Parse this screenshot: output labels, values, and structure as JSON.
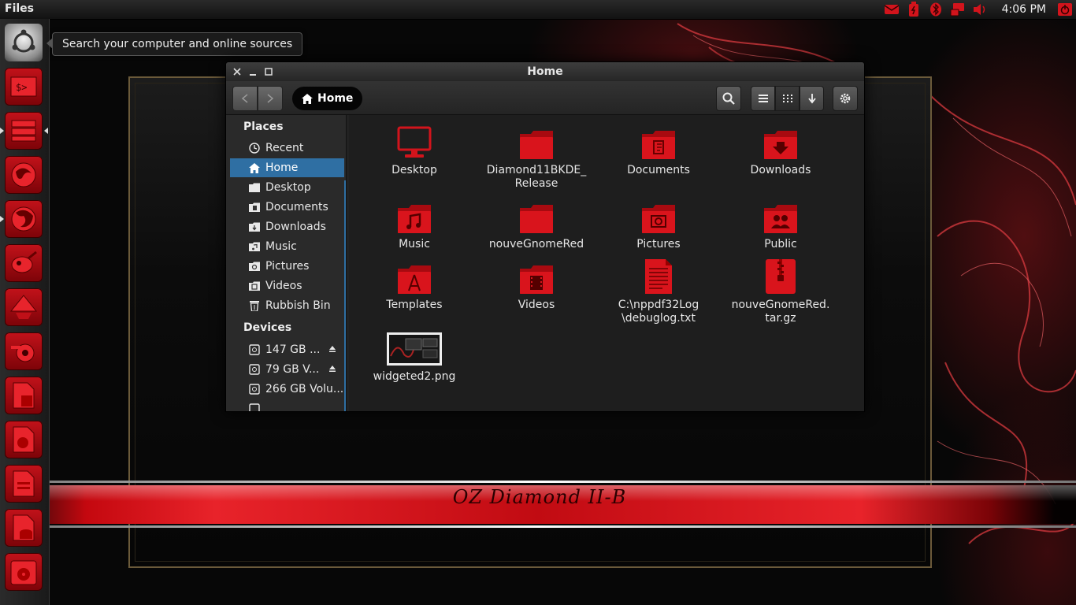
{
  "panel": {
    "app_title": "Files",
    "clock": "4:06 PM"
  },
  "dash_tooltip": "Search your computer and online sources",
  "wallpaper": {
    "banner_text": "OZ Diamond II-B"
  },
  "launcher": {
    "items": [
      "dash-home-icon",
      "terminal-icon",
      "file-manager-icon",
      "browser-icon",
      "firefox-icon",
      "gimp-icon",
      "inkscape-icon",
      "blender-icon",
      "libreoffice-draw-icon",
      "libreoffice-impress-icon",
      "libreoffice-writer-icon",
      "libreoffice-base-icon",
      "disk-app-icon"
    ]
  },
  "window": {
    "title": "Home",
    "path": "Home"
  },
  "sidebar": {
    "places_heading": "Places",
    "places": [
      {
        "label": "Recent",
        "icon": "clock-icon"
      },
      {
        "label": "Home",
        "icon": "home-icon",
        "selected": true
      },
      {
        "label": "Desktop",
        "icon": "folder-icon"
      },
      {
        "label": "Documents",
        "icon": "documents-folder-icon"
      },
      {
        "label": "Downloads",
        "icon": "downloads-folder-icon"
      },
      {
        "label": "Music",
        "icon": "music-folder-icon"
      },
      {
        "label": "Pictures",
        "icon": "pictures-folder-icon"
      },
      {
        "label": "Videos",
        "icon": "videos-folder-icon"
      },
      {
        "label": "Rubbish Bin",
        "icon": "trash-icon"
      }
    ],
    "devices_heading": "Devices",
    "devices": [
      {
        "label": "147 GB ...",
        "eject": true
      },
      {
        "label": "79 GB V...",
        "eject": true
      },
      {
        "label": "266 GB Volu...",
        "eject": false
      }
    ]
  },
  "files": [
    {
      "label": "Desktop",
      "icon": "desktop-monitor-icon"
    },
    {
      "label": "Diamond11BKDE_\nRelease",
      "icon": "folder-icon"
    },
    {
      "label": "Documents",
      "icon": "documents-folder-icon"
    },
    {
      "label": "Downloads",
      "icon": "downloads-folder-icon"
    },
    {
      "label": "Music",
      "icon": "music-folder-icon"
    },
    {
      "label": "nouveGnomeRed",
      "icon": "folder-icon"
    },
    {
      "label": "Pictures",
      "icon": "pictures-folder-icon"
    },
    {
      "label": "Public",
      "icon": "public-folder-icon"
    },
    {
      "label": "Templates",
      "icon": "templates-folder-icon"
    },
    {
      "label": "Videos",
      "icon": "videos-folder-icon"
    },
    {
      "label": "C:\\nppdf32Log\n\\debuglog.txt",
      "icon": "text-file-icon"
    },
    {
      "label": "nouveGnomeRed.\ntar.gz",
      "icon": "archive-file-icon"
    },
    {
      "label": "widgeted2.png",
      "icon": "image-thumbnail-icon"
    }
  ],
  "colors": {
    "accent_red": "#c8101a",
    "selection_blue": "#2f6fa3",
    "window_bg": "#1e1e1e"
  }
}
